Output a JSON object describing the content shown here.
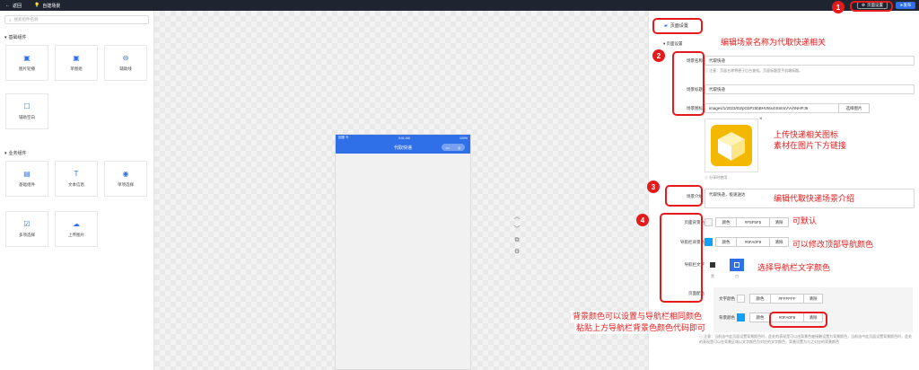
{
  "topbar": {
    "back": "返回",
    "scene": "自建场景",
    "page_settings": "页面设置",
    "publish": "发布"
  },
  "left": {
    "search_placeholder": "搜索组件名称",
    "group_basic": "基础组件",
    "basic_items": [
      "图片轮播",
      "单图组",
      "辅助线",
      "辅助空白"
    ],
    "group_business": "业务组件",
    "business_items": [
      "基础组件",
      "文本信息",
      "单项选择",
      "多项选择",
      "上传图片"
    ]
  },
  "phone": {
    "carrier": "回报 令",
    "time": "9:41 AM",
    "battery": "100%",
    "title": "代取快递"
  },
  "right": {
    "tab": "页面设置",
    "section": "页面设置",
    "name_label": "场景名称",
    "name_value": "代取快递",
    "name_hint": "注意：页面名称将便于后台查找。页面标题是手机端标题。",
    "title_label": "场景标题",
    "title_value": "代取快递",
    "icon_label": "场景图标",
    "icon_value": "images/1/2023/03/pGbPz5bBHVt6s4ISntmVVvhNHPJ5",
    "choose_image": "选择图片",
    "share_hint": "分享时使用",
    "intro_label": "场景介绍",
    "intro_value": "代取快递，极速送达",
    "bg_label": "页面背景色",
    "bg_tab": "颜色",
    "bg_value": "#F5F5F5",
    "bg_clear": "清除",
    "navbg_label": "导航栏背景色",
    "navbg_tab": "颜色",
    "navbg_value": "#0FA0F9",
    "navbg_clear": "清除",
    "navtext_label": "导航栏文字",
    "navtext_black": "黑",
    "navtext_white": "白",
    "pagecolor_label": "页面配色",
    "textcolor_label": "文字颜色",
    "textcolor_tab": "颜色",
    "textcolor_value": "#FFFFFF",
    "textcolor_clear": "清除",
    "bgcolor_label": "背景颜色",
    "bgcolor_tab": "颜色",
    "bgcolor_value": "#0FA0F9",
    "bgcolor_clear": "清除",
    "bottom_hint": "注意：当前选中此页面设置背景颜色时，此处的表现是可以由背景色被接触设置为背景颜色，当前选中此页面设置背景颜色时，此处的表现是可以在背景区域以文字颜色为对应的文字颜色，背景设置为与之对应的背景颜色"
  },
  "annotations": {
    "n1": "1",
    "n2": "2",
    "n3": "3",
    "n4": "4",
    "a_name": "编辑场景名称为代取快递相关",
    "a_icon_1": "上传快递相关图标",
    "a_icon_2": "素材在图片下方链接",
    "a_intro": "编辑代取快递场景介绍",
    "a_default": "可默认",
    "a_nav": "可以修改顶部导航颜色",
    "a_text": "选择导航栏文字颜色",
    "a_bg_1": "背景颜色可以设置与导航栏相同颜色",
    "a_bg_2": "粘贴上方导航栏背景色颜色代码即可"
  },
  "colors": {
    "accent": "#2f6fe8",
    "annotation": "#e51b1b",
    "nav": "#0FA0F9",
    "topbar": "#1e2430",
    "icon_yellow": "#f5b800"
  }
}
